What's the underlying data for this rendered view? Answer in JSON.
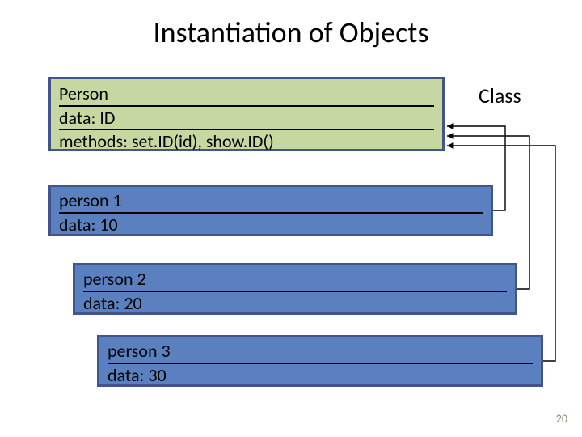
{
  "title": "Instantiation of Objects",
  "class_label": "Class",
  "class_box": {
    "name": "Person",
    "data_line": "data: ID",
    "methods_line": "methods: set.ID(id), show.ID()"
  },
  "instances": [
    {
      "name": "person 1",
      "data_line": "data: 10"
    },
    {
      "name": "person 2",
      "data_line": "data: 20"
    },
    {
      "name": "person 3",
      "data_line": "data: 30"
    }
  ],
  "page_number": "20",
  "chart_data": {
    "type": "table",
    "title": "Instantiation of Objects",
    "class": {
      "name": "Person",
      "data": "ID",
      "methods": [
        "set.ID(id)",
        "show.ID()"
      ]
    },
    "instances": [
      {
        "name": "person 1",
        "data": 10
      },
      {
        "name": "person 2",
        "data": 20
      },
      {
        "name": "person 3",
        "data": 30
      }
    ]
  }
}
